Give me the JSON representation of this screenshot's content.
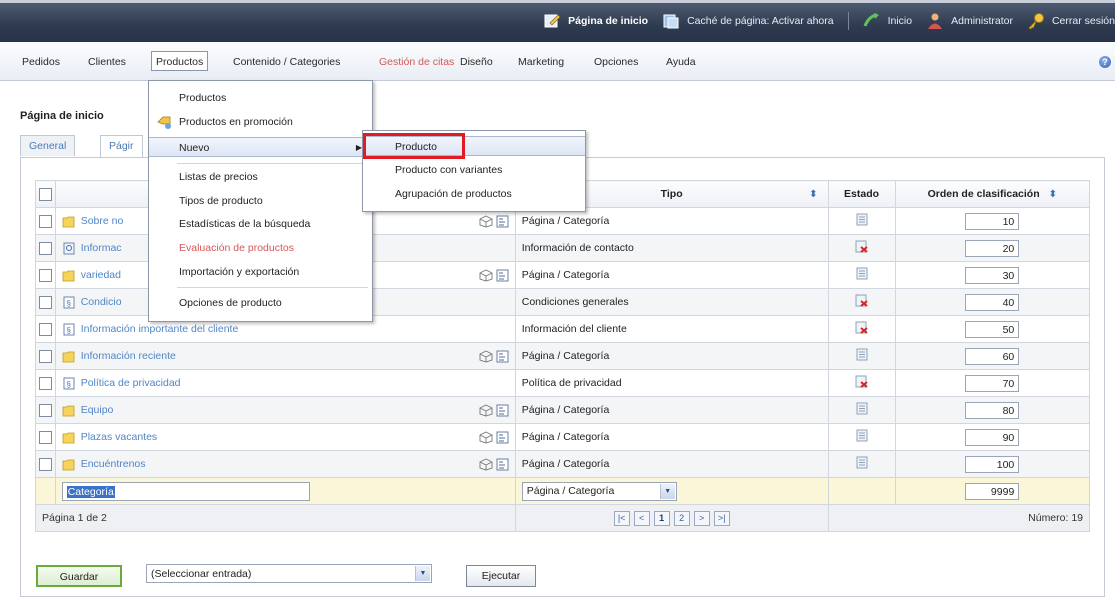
{
  "topbar": {
    "home_label": "Página de inicio",
    "cache_label": "Caché de página: Activar ahora",
    "start_label": "Inicio",
    "admin_label": "Administrator",
    "logout_label": "Cerrar sesión"
  },
  "mainmenu": {
    "items": [
      {
        "label": "Pedidos"
      },
      {
        "label": "Clientes"
      },
      {
        "label": "Productos"
      },
      {
        "label": "Contenido / Categories"
      },
      {
        "label": "Gestión de citas"
      },
      {
        "label": "Diseño"
      },
      {
        "label": "Marketing"
      },
      {
        "label": "Opciones"
      },
      {
        "label": "Ayuda"
      }
    ],
    "help_glyph": "?"
  },
  "page": {
    "title": "Página de inicio",
    "tabs": [
      {
        "label": "General"
      },
      {
        "label": "Págir"
      }
    ]
  },
  "products_menu": {
    "items": [
      {
        "label": "Productos"
      },
      {
        "label": "Productos en promoción"
      },
      {
        "label": "Nuevo"
      },
      {
        "label": "Listas de precios"
      },
      {
        "label": "Tipos de producto"
      },
      {
        "label": "Estadísticas de la búsqueda"
      },
      {
        "label": "Evaluación de productos"
      },
      {
        "label": "Importación y exportación"
      },
      {
        "label": "Opciones de producto"
      }
    ],
    "arrow": "▶"
  },
  "new_submenu": {
    "items": [
      {
        "label": "Producto"
      },
      {
        "label": "Producto con variantes"
      },
      {
        "label": "Agrupación de productos"
      }
    ]
  },
  "table": {
    "columns": {
      "type": "Tipo",
      "state": "Estado",
      "order": "Orden de clasificación"
    },
    "sort_glyph": "⬍",
    "rows": [
      {
        "name": "Sobre no",
        "type": "Página / Categoría",
        "order": "10"
      },
      {
        "name": "Informac",
        "type": "Información de contacto",
        "order": "20"
      },
      {
        "name": "variedad",
        "type": "Página / Categoría",
        "order": "30"
      },
      {
        "name": "Condicio",
        "type": "Condiciones generales",
        "order": "40"
      },
      {
        "name": "Información importante del cliente",
        "type": "Información del cliente",
        "order": "50"
      },
      {
        "name": "Información reciente",
        "type": "Página / Categoría",
        "order": "60"
      },
      {
        "name": "Política de privacidad",
        "type": "Política de privacidad",
        "order": "70"
      },
      {
        "name": "Equipo",
        "type": "Página / Categoría",
        "order": "80"
      },
      {
        "name": "Plazas vacantes",
        "type": "Página / Categoría",
        "order": "90"
      },
      {
        "name": "Encuéntrenos",
        "type": "Página / Categoría",
        "order": "100"
      }
    ],
    "new_row": {
      "name": "Categoría",
      "type": "Página / Categoría",
      "order": "9999"
    },
    "footer": {
      "page_info": "Página 1 de 2",
      "pager": [
        "|<",
        "<",
        "1",
        "2",
        ">",
        ">|"
      ],
      "count": "Número: 19"
    }
  },
  "actions": {
    "save_label": "Guardar",
    "select_value": "(Seleccionar entrada)",
    "execute_label": "Ejecutar"
  }
}
